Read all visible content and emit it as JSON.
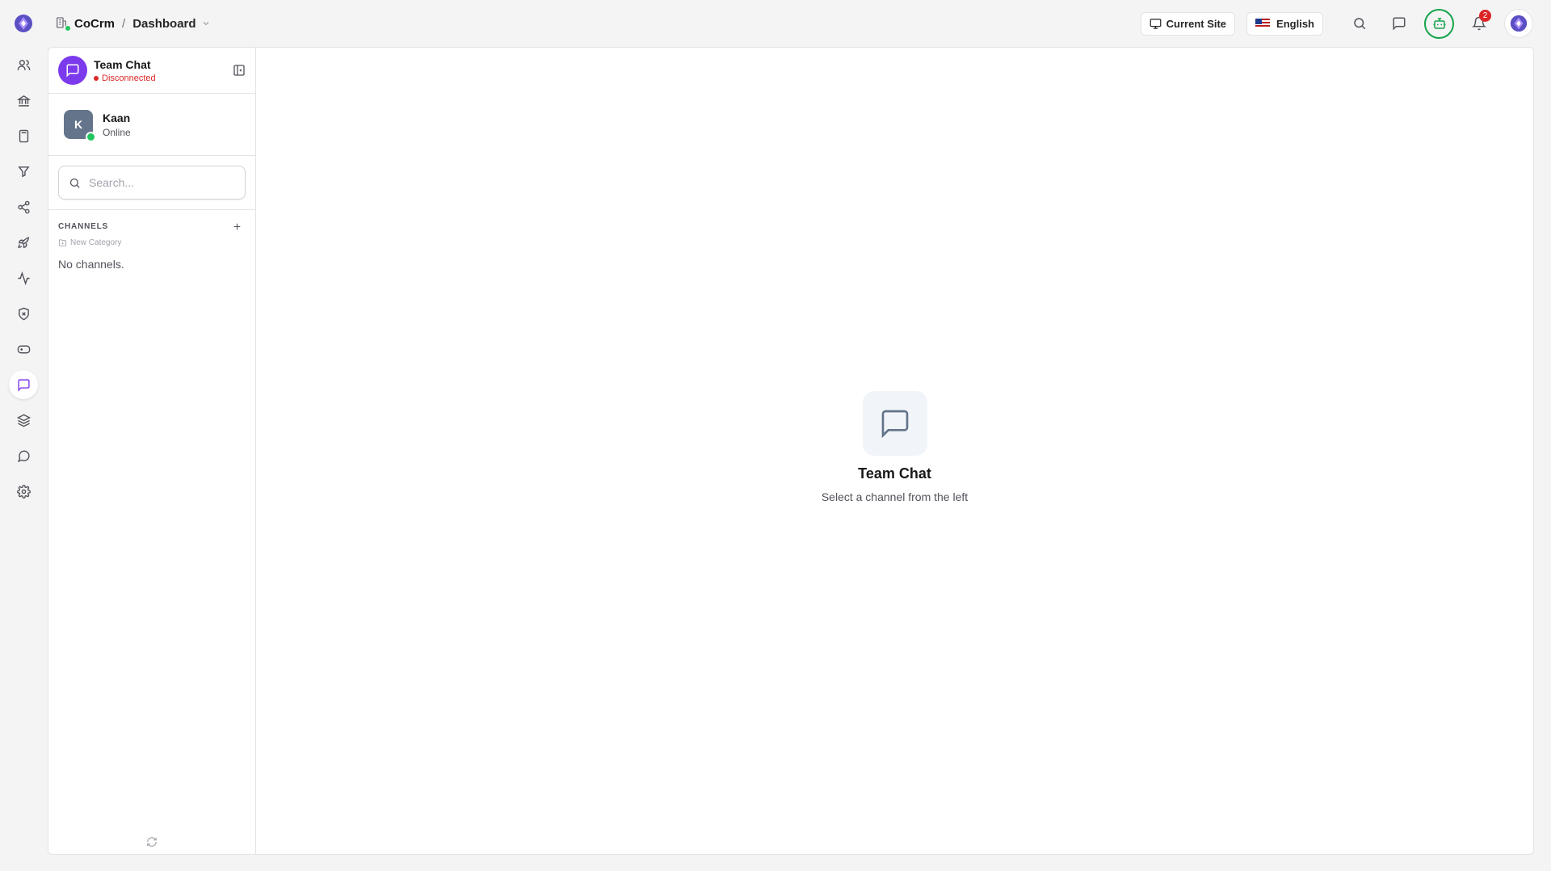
{
  "app": {
    "name": "CoCrm",
    "page": "Dashboard"
  },
  "rail": {
    "logo": "cocrm-logo",
    "items": [
      {
        "icon": "users-icon",
        "active": false
      },
      {
        "icon": "bank-icon",
        "active": false
      },
      {
        "icon": "calculator-icon",
        "active": false
      },
      {
        "icon": "filter-icon",
        "active": false
      },
      {
        "icon": "share-icon",
        "active": false
      },
      {
        "icon": "rocket-icon",
        "active": false
      },
      {
        "icon": "activity-icon",
        "active": false
      },
      {
        "icon": "shield-x-icon",
        "active": false
      },
      {
        "icon": "gamepad-icon",
        "active": false
      },
      {
        "icon": "message-square-icon",
        "active": true
      },
      {
        "icon": "layers-icon",
        "active": false
      },
      {
        "icon": "message-circle-icon",
        "active": false
      },
      {
        "icon": "settings-icon",
        "active": false
      }
    ]
  },
  "topbar": {
    "current_site_label": "Current Site",
    "language_label": "English",
    "notification_count": "2"
  },
  "chat": {
    "title": "Team Chat",
    "connection_status": "Disconnected",
    "user": {
      "initial": "K",
      "name": "Kaan",
      "status": "Online"
    },
    "search_placeholder": "Search...",
    "channels_heading": "CHANNELS",
    "new_category_label": "New Category",
    "no_channels_text": "No channels."
  },
  "empty_state": {
    "title": "Team Chat",
    "subtitle": "Select a channel from the left"
  },
  "colors": {
    "accent": "#7c3aed",
    "online": "#22c55e",
    "error": "#dc2626",
    "bot": "#16a34a"
  }
}
